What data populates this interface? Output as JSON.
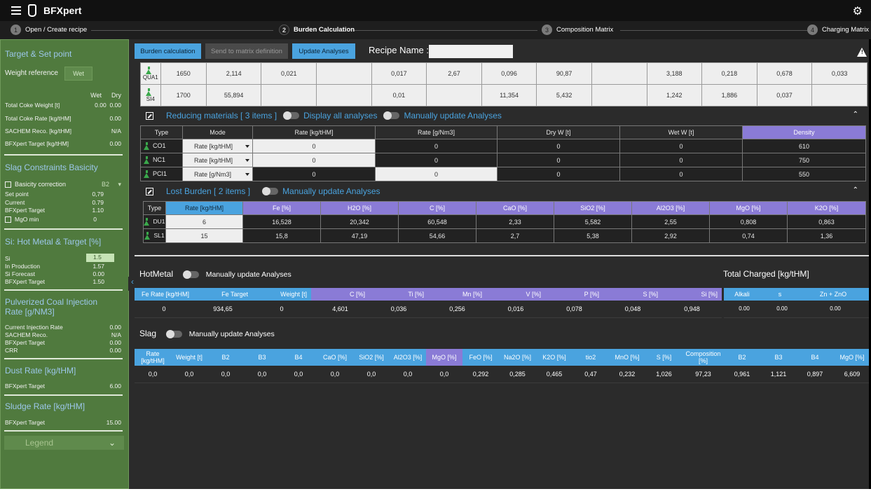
{
  "app": {
    "title": "BFXpert"
  },
  "steps": [
    {
      "num": "1",
      "label": "Open / Create recipe"
    },
    {
      "num": "2",
      "label": "Burden Calculation"
    },
    {
      "num": "3",
      "label": "Composition Matrix"
    },
    {
      "num": "4",
      "label": "Charging Matrix"
    }
  ],
  "sidebar": {
    "target_title": "Target & Set point",
    "weight_ref_label": "Weight reference",
    "weight_ref_value": "Wet",
    "col_wet": "Wet",
    "col_dry": "Dry",
    "coke_weight": {
      "label": "Total Coke Weight [t]",
      "wet": "0.00",
      "dry": "0.00"
    },
    "coke_rate": {
      "label": "Total Coke Rate [kg/tHM]",
      "value": "0.00"
    },
    "sachem": {
      "label": "SACHEM Reco. [kg/tHM]",
      "value": "N/A"
    },
    "bfx_target": {
      "label": "BFXpert Target [kg/tHM]",
      "value": "0.00"
    },
    "slag_title": "Slag Constraints Basicity",
    "basicity_label": "Basicity correction",
    "basicity_value": "B2",
    "setpoint": {
      "label": "Set point",
      "value": "0,79"
    },
    "current": {
      "label": "Current",
      "value": "0.79"
    },
    "bfx_target2": {
      "label": "BFXpert Target",
      "value": "1.10"
    },
    "mgo": {
      "label": "MgO min",
      "value": "0"
    },
    "si_title": "Si: Hot Metal & Target [%]",
    "si": {
      "label": "Si",
      "value": "1.5"
    },
    "in_prod": {
      "label": "In Production",
      "value": "1.57"
    },
    "si_forecast": {
      "label": "Si Forecast",
      "value": "0.00"
    },
    "bfx_target3": {
      "label": "BFXpert Target",
      "value": "1.50"
    },
    "pci_title": "Pulverized Coal Injection Rate [g/NM3]",
    "cur_inj": {
      "label": "Current Injection Rate",
      "value": "0.00"
    },
    "sachem2": {
      "label": "SACHEM Reco.",
      "value": "N/A"
    },
    "bfx_target4": {
      "label": "BFXpert Target",
      "value": "0.00"
    },
    "crr": {
      "label": "CRR",
      "value": "0.00"
    },
    "dust_title": "Dust Rate [kg/tHM]",
    "dust_target": {
      "label": "BFXpert Target",
      "value": "6.00"
    },
    "sludge_title": "Sludge Rate [kg/tHM]",
    "sludge_target": {
      "label": "BFXpert Target",
      "value": "15.00"
    },
    "legend": "Legend"
  },
  "toolbar": {
    "burden_calc": "Burden calculation",
    "send_matrix": "Send to matrix definition",
    "update_analyses": "Update Analyses",
    "recipe_label": "Recipe Name :",
    "recipe_value": ""
  },
  "materials": [
    {
      "name": "QUA1",
      "cells": [
        "1650",
        "2,114",
        "0,021",
        "",
        "0,017",
        "2,67",
        "0,096",
        "90,87",
        "",
        "3,188",
        "0,218",
        "0,678",
        "0,033"
      ]
    },
    {
      "name": "SI4",
      "cells": [
        "1700",
        "55,894",
        "",
        "",
        "0,01",
        "",
        "11,354",
        "5,432",
        "",
        "1,242",
        "1,886",
        "0,037",
        ""
      ]
    }
  ],
  "reducing": {
    "title": "Reducing materials [ 3 items ]",
    "toggle1": "Display all analyses",
    "toggle2": "Manually update Analyses",
    "headers": [
      "Type",
      "Mode",
      "Rate [kg/tHM]",
      "Rate [g/Nm3]",
      "Dry W [t]",
      "Wet W [t]",
      "Density"
    ],
    "rows": [
      {
        "type": "CO1",
        "mode": "Rate [kg/tHM]",
        "rate_kg": "0",
        "rate_g": "0",
        "dry": "0",
        "wet": "0",
        "density": "610"
      },
      {
        "type": "NC1",
        "mode": "Rate [kg/tHM]",
        "rate_kg": "0",
        "rate_g": "0",
        "dry": "0",
        "wet": "0",
        "density": "750"
      },
      {
        "type": "PCI1",
        "mode": "Rate [g/Nm3]",
        "rate_kg": "0",
        "rate_g": "0",
        "dry": "0",
        "wet": "0",
        "density": "550"
      }
    ]
  },
  "lost": {
    "title": "Lost Burden [ 2 items ]",
    "toggle": "Manually update Analyses",
    "headers": [
      "Type",
      "Rate [kg/tHM]",
      "Fe [%]",
      "H2O [%]",
      "C [%]",
      "CaO [%]",
      "SiO2 [%]",
      "Al2O3 [%]",
      "MgO [%]",
      "K2O [%]"
    ],
    "rows": [
      {
        "type": "DU1",
        "vals": [
          "6",
          "16,528",
          "20,342",
          "60,548",
          "2,33",
          "5,582",
          "2,55",
          "0,808",
          "0,863"
        ]
      },
      {
        "type": "SL1",
        "vals": [
          "15",
          "15,8",
          "47,19",
          "54,66",
          "2,7",
          "5,38",
          "2,92",
          "0,74",
          "1,36"
        ]
      }
    ]
  },
  "hotmetal": {
    "title": "HotMetal",
    "toggle": "Manually update Analyses",
    "total_title": "Total Charged [kg/tHM]",
    "headers": [
      "Fe Rate [kg/tHM]",
      "Fe Target",
      "Weight [t]",
      "C [%]",
      "Ti [%]",
      "Mn [%]",
      "V [%]",
      "P [%]",
      "S [%]",
      "Si [%]"
    ],
    "values": [
      "0",
      "934,65",
      "0",
      "4,601",
      "0,036",
      "0,256",
      "0,016",
      "0,078",
      "0,048",
      "0,948"
    ],
    "total_headers": [
      "Alkali",
      "s",
      "Zn + ZnO"
    ],
    "total_values": [
      "0.00",
      "0.00",
      "0.00"
    ]
  },
  "slag": {
    "title": "Slag",
    "toggle": "Manually update Analyses",
    "headers": [
      "Rate [kg/tHM]",
      "Weight [t]",
      "B2",
      "B3",
      "B4",
      "CaO [%]",
      "SiO2 [%]",
      "Al2O3 [%]",
      "MgO [%]",
      "FeO [%]",
      "Na2O [%]",
      "K2O [%]",
      "tio2",
      "MnO [%]",
      "S [%]",
      "Composition [%]",
      "B2",
      "B3",
      "B4",
      "MgO [%]"
    ],
    "values": [
      "0,0",
      "0,0",
      "0,0",
      "0,0",
      "0,0",
      "0,0",
      "0,0",
      "0,0",
      "0,0",
      "0,292",
      "0,285",
      "0,465",
      "0,47",
      "0,232",
      "1,026",
      "97,23",
      "0,961",
      "1,121",
      "0,897",
      "6,609"
    ]
  }
}
